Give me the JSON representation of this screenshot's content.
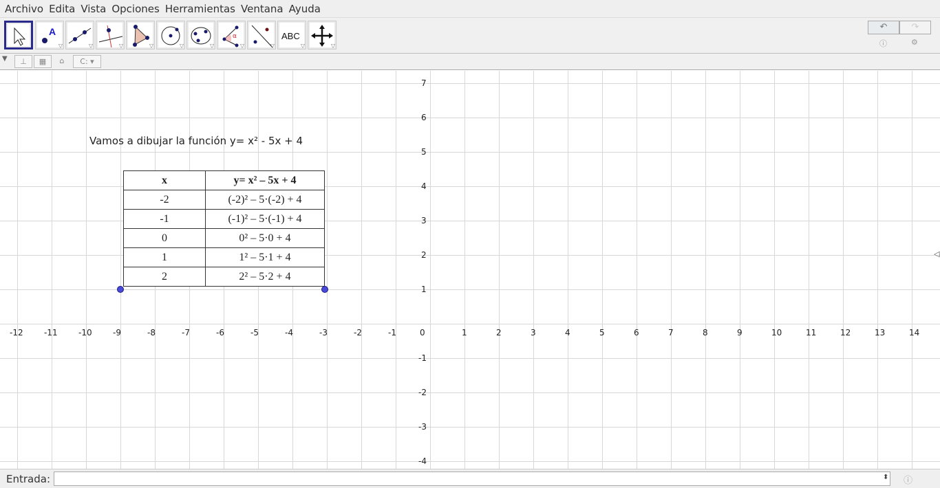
{
  "menu": [
    "Archivo",
    "Edita",
    "Vista",
    "Opciones",
    "Herramientas",
    "Ventana",
    "Ayuda"
  ],
  "tools": [
    "move",
    "point",
    "line",
    "perpendicular",
    "polygon",
    "circle",
    "conic",
    "angle",
    "reflect",
    "text",
    "move-graphics"
  ],
  "tool_text_label": "ABC",
  "stylebar": {
    "point_capture": "C:"
  },
  "graphics": {
    "caption": "Vamos a dibujar la función y= x² - 5x + 4",
    "x_ticks": [
      "-12",
      "-11",
      "-10",
      "-9",
      "-8",
      "-7",
      "-6",
      "-5",
      "-4",
      "-3",
      "-2",
      "-1",
      "0",
      "1",
      "2",
      "3",
      "4",
      "5",
      "6",
      "7",
      "8",
      "9",
      "10",
      "11",
      "12",
      "13",
      "14"
    ],
    "y_ticks": [
      "7",
      "6",
      "5",
      "4",
      "3",
      "2",
      "1",
      "-1",
      "-2",
      "-3",
      "-4"
    ],
    "table": {
      "headers": [
        "x",
        "y= x² – 5x + 4"
      ],
      "rows": [
        [
          "-2",
          "(-2)² – 5·(-2) + 4"
        ],
        [
          "-1",
          "(-1)² – 5·(-1) + 4"
        ],
        [
          "0",
          "0² – 5·0 + 4"
        ],
        [
          "1",
          "1² – 5·1 + 4"
        ],
        [
          "2",
          "2² – 5·2 + 4"
        ]
      ]
    }
  },
  "input_bar": {
    "label": "Entrada:",
    "value": ""
  }
}
